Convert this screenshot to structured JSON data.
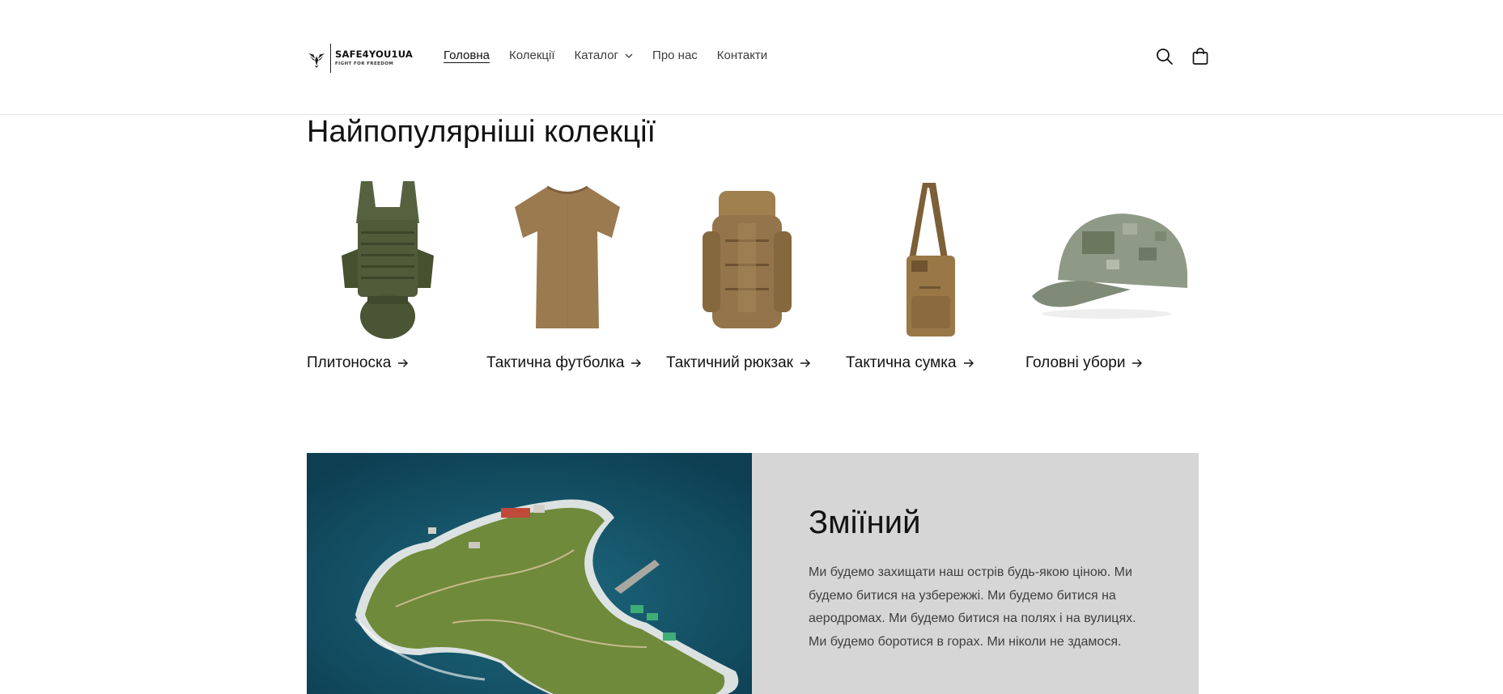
{
  "header": {
    "brand": "SAFE4YOU1UA",
    "tagline": "FIGHT FOR FREEDOM",
    "nav": [
      {
        "label": "Головна",
        "active": true
      },
      {
        "label": "Колекції",
        "active": false
      },
      {
        "label": "Каталог",
        "active": false,
        "has_dropdown": true
      },
      {
        "label": "Про нас",
        "active": false
      },
      {
        "label": "Контакти",
        "active": false
      }
    ],
    "icons": [
      "search-icon",
      "cart-icon"
    ]
  },
  "collections": {
    "title": "Найпопулярніші колекції",
    "items": [
      {
        "label": "Плитоноска",
        "image": "plate-carrier"
      },
      {
        "label": "Тактична футболка",
        "image": "tactical-tshirt"
      },
      {
        "label": "Тактичний рюкзак",
        "image": "tactical-backpack"
      },
      {
        "label": "Тактична сумка",
        "image": "tactical-bag"
      },
      {
        "label": "Головні убори",
        "image": "camo-cap"
      }
    ]
  },
  "banner": {
    "title": "Зміїний",
    "text": "Ми будемо захищати наш острів будь-якою ціною. Ми будемо битися на узбережжі. Ми будемо битися на аеродромах. Ми будемо битися на полях і на вулицях. Ми будемо боротися в горах. Ми ніколи не здамося.",
    "image": "aerial-island-photo"
  },
  "colors": {
    "text": "#121212",
    "nav_text": "#3d3d3d",
    "banner_bg": "#d6d6d6",
    "sea": "#145066",
    "olive": "#4b5a3c",
    "coyote": "#9c7a4f"
  }
}
